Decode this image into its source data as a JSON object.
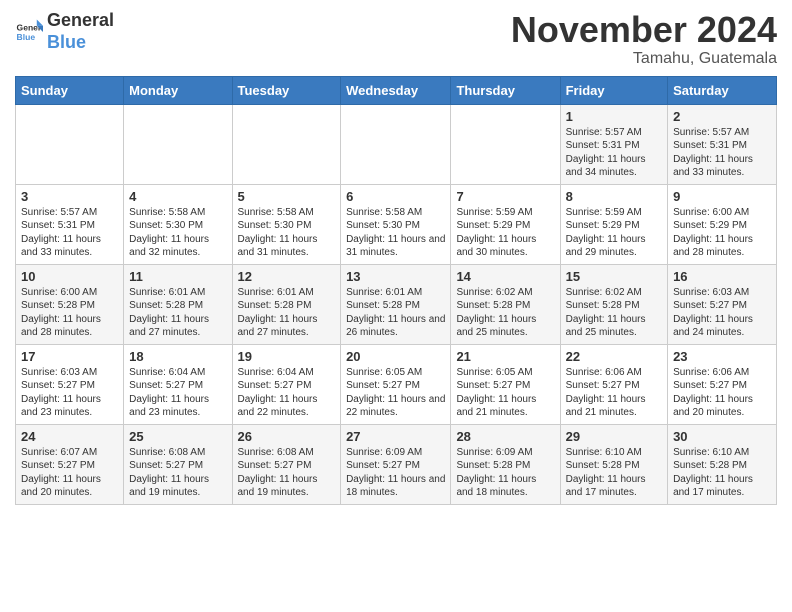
{
  "header": {
    "logo_general": "General",
    "logo_blue": "Blue",
    "month_title": "November 2024",
    "location": "Tamahu, Guatemala"
  },
  "days_of_week": [
    "Sunday",
    "Monday",
    "Tuesday",
    "Wednesday",
    "Thursday",
    "Friday",
    "Saturday"
  ],
  "weeks": [
    [
      {
        "day": "",
        "content": ""
      },
      {
        "day": "",
        "content": ""
      },
      {
        "day": "",
        "content": ""
      },
      {
        "day": "",
        "content": ""
      },
      {
        "day": "",
        "content": ""
      },
      {
        "day": "1",
        "content": "Sunrise: 5:57 AM\nSunset: 5:31 PM\nDaylight: 11 hours and 34 minutes."
      },
      {
        "day": "2",
        "content": "Sunrise: 5:57 AM\nSunset: 5:31 PM\nDaylight: 11 hours and 33 minutes."
      }
    ],
    [
      {
        "day": "3",
        "content": "Sunrise: 5:57 AM\nSunset: 5:31 PM\nDaylight: 11 hours and 33 minutes."
      },
      {
        "day": "4",
        "content": "Sunrise: 5:58 AM\nSunset: 5:30 PM\nDaylight: 11 hours and 32 minutes."
      },
      {
        "day": "5",
        "content": "Sunrise: 5:58 AM\nSunset: 5:30 PM\nDaylight: 11 hours and 31 minutes."
      },
      {
        "day": "6",
        "content": "Sunrise: 5:58 AM\nSunset: 5:30 PM\nDaylight: 11 hours and 31 minutes."
      },
      {
        "day": "7",
        "content": "Sunrise: 5:59 AM\nSunset: 5:29 PM\nDaylight: 11 hours and 30 minutes."
      },
      {
        "day": "8",
        "content": "Sunrise: 5:59 AM\nSunset: 5:29 PM\nDaylight: 11 hours and 29 minutes."
      },
      {
        "day": "9",
        "content": "Sunrise: 6:00 AM\nSunset: 5:29 PM\nDaylight: 11 hours and 28 minutes."
      }
    ],
    [
      {
        "day": "10",
        "content": "Sunrise: 6:00 AM\nSunset: 5:28 PM\nDaylight: 11 hours and 28 minutes."
      },
      {
        "day": "11",
        "content": "Sunrise: 6:01 AM\nSunset: 5:28 PM\nDaylight: 11 hours and 27 minutes."
      },
      {
        "day": "12",
        "content": "Sunrise: 6:01 AM\nSunset: 5:28 PM\nDaylight: 11 hours and 27 minutes."
      },
      {
        "day": "13",
        "content": "Sunrise: 6:01 AM\nSunset: 5:28 PM\nDaylight: 11 hours and 26 minutes."
      },
      {
        "day": "14",
        "content": "Sunrise: 6:02 AM\nSunset: 5:28 PM\nDaylight: 11 hours and 25 minutes."
      },
      {
        "day": "15",
        "content": "Sunrise: 6:02 AM\nSunset: 5:28 PM\nDaylight: 11 hours and 25 minutes."
      },
      {
        "day": "16",
        "content": "Sunrise: 6:03 AM\nSunset: 5:27 PM\nDaylight: 11 hours and 24 minutes."
      }
    ],
    [
      {
        "day": "17",
        "content": "Sunrise: 6:03 AM\nSunset: 5:27 PM\nDaylight: 11 hours and 23 minutes."
      },
      {
        "day": "18",
        "content": "Sunrise: 6:04 AM\nSunset: 5:27 PM\nDaylight: 11 hours and 23 minutes."
      },
      {
        "day": "19",
        "content": "Sunrise: 6:04 AM\nSunset: 5:27 PM\nDaylight: 11 hours and 22 minutes."
      },
      {
        "day": "20",
        "content": "Sunrise: 6:05 AM\nSunset: 5:27 PM\nDaylight: 11 hours and 22 minutes."
      },
      {
        "day": "21",
        "content": "Sunrise: 6:05 AM\nSunset: 5:27 PM\nDaylight: 11 hours and 21 minutes."
      },
      {
        "day": "22",
        "content": "Sunrise: 6:06 AM\nSunset: 5:27 PM\nDaylight: 11 hours and 21 minutes."
      },
      {
        "day": "23",
        "content": "Sunrise: 6:06 AM\nSunset: 5:27 PM\nDaylight: 11 hours and 20 minutes."
      }
    ],
    [
      {
        "day": "24",
        "content": "Sunrise: 6:07 AM\nSunset: 5:27 PM\nDaylight: 11 hours and 20 minutes."
      },
      {
        "day": "25",
        "content": "Sunrise: 6:08 AM\nSunset: 5:27 PM\nDaylight: 11 hours and 19 minutes."
      },
      {
        "day": "26",
        "content": "Sunrise: 6:08 AM\nSunset: 5:27 PM\nDaylight: 11 hours and 19 minutes."
      },
      {
        "day": "27",
        "content": "Sunrise: 6:09 AM\nSunset: 5:27 PM\nDaylight: 11 hours and 18 minutes."
      },
      {
        "day": "28",
        "content": "Sunrise: 6:09 AM\nSunset: 5:28 PM\nDaylight: 11 hours and 18 minutes."
      },
      {
        "day": "29",
        "content": "Sunrise: 6:10 AM\nSunset: 5:28 PM\nDaylight: 11 hours and 17 minutes."
      },
      {
        "day": "30",
        "content": "Sunrise: 6:10 AM\nSunset: 5:28 PM\nDaylight: 11 hours and 17 minutes."
      }
    ]
  ]
}
